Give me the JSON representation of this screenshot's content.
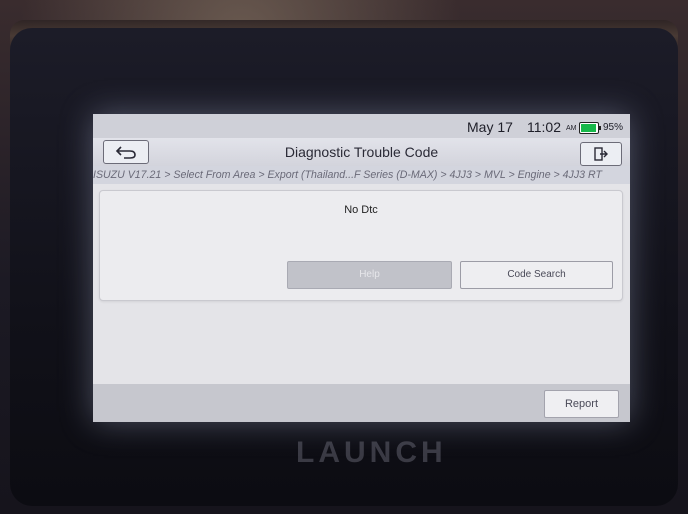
{
  "device": {
    "brand": "LAUNCH"
  },
  "status": {
    "date": "May 17",
    "time": "11:02",
    "ampm": "AM",
    "battery_percent": 95,
    "battery_label": "95%"
  },
  "header": {
    "title": "Diagnostic Trouble Code",
    "back_icon": "back-arrow-icon",
    "exit_icon": "exit-door-icon"
  },
  "breadcrumb": "ISUZU V17.21 > Select From Area > Export (Thailand...F Series (D-MAX) > 4JJ3 > MVL > Engine > 4JJ3 RT",
  "dtc": {
    "message": "No Dtc"
  },
  "buttons": {
    "help": "Help",
    "code_search": "Code Search",
    "report": "Report"
  },
  "colors": {
    "battery": "#17b84a",
    "screen_bg": "#e7e7ea"
  }
}
